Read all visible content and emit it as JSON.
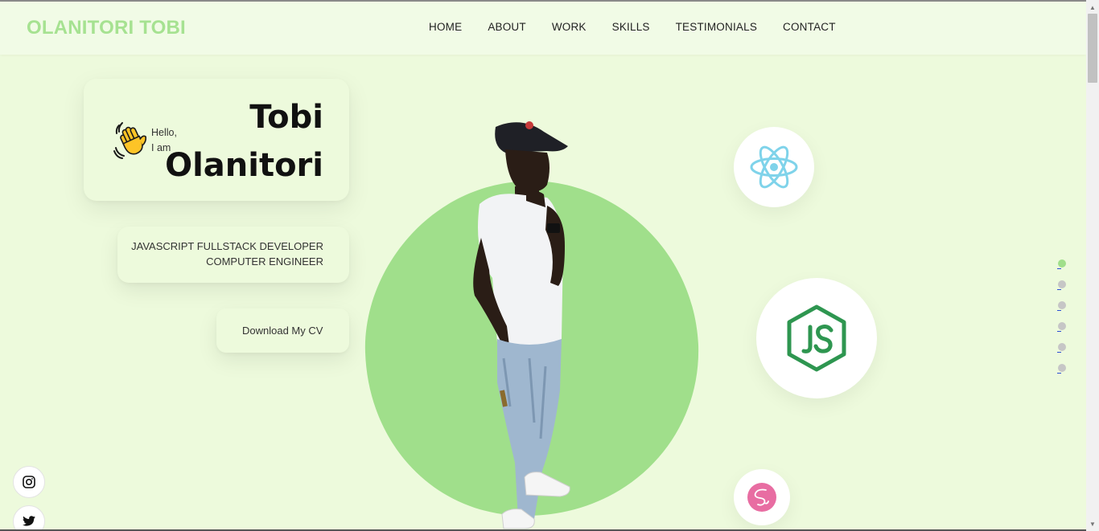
{
  "logo": "OLANITORI TOBI",
  "nav": {
    "items": [
      {
        "label": "HOME"
      },
      {
        "label": "ABOUT"
      },
      {
        "label": "WORK"
      },
      {
        "label": "SKILLS"
      },
      {
        "label": "TESTIMONIALS"
      },
      {
        "label": "CONTACT"
      }
    ]
  },
  "intro": {
    "greeting_line1": "Hello,",
    "greeting_line2": "I am",
    "first_name": "Tobi",
    "last_name": "Olanitori"
  },
  "roles": {
    "line1": "JAVASCRIPT FULLSTACK DEVELOPER",
    "line2": "COMPUTER ENGINEER"
  },
  "cv_button": "Download My CV",
  "page_dots": {
    "count": 6,
    "active_index": 0
  },
  "tech_icons": [
    "react-icon",
    "nodejs-icon",
    "sass-icon"
  ],
  "socials": [
    "instagram-icon",
    "twitter-icon"
  ],
  "colors": {
    "accent": "#a0df8b",
    "background": "#edfadc",
    "react": "#7fd3ea",
    "node": "#2e9650",
    "sass": "#e86da2"
  }
}
